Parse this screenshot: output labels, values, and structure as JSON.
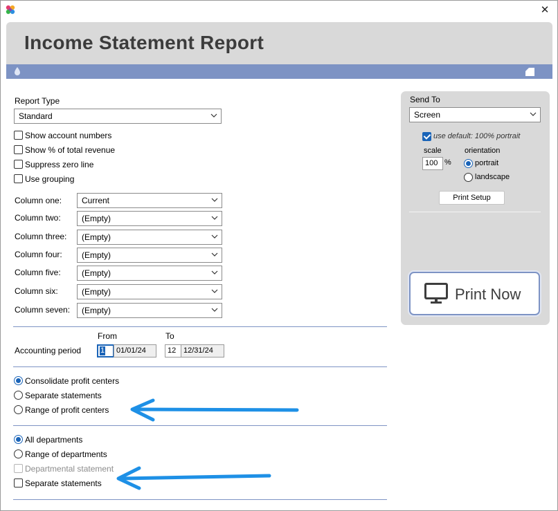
{
  "window": {
    "title": "Income Statement Report",
    "close_label": "✕"
  },
  "report_type": {
    "label": "Report Type",
    "value": "Standard",
    "options_checks": [
      {
        "label": "Show account numbers",
        "checked": false
      },
      {
        "label": "Show % of total revenue",
        "checked": false
      },
      {
        "label": "Suppress zero line",
        "checked": false
      },
      {
        "label": "Use grouping",
        "checked": false
      }
    ]
  },
  "columns": [
    {
      "label": "Column one:",
      "value": "Current"
    },
    {
      "label": "Column two:",
      "value": "(Empty)"
    },
    {
      "label": "Column three:",
      "value": "(Empty)"
    },
    {
      "label": "Column four:",
      "value": "(Empty)"
    },
    {
      "label": "Column five:",
      "value": "(Empty)"
    },
    {
      "label": "Column six:",
      "value": "(Empty)"
    },
    {
      "label": "Column seven:",
      "value": "(Empty)"
    }
  ],
  "period": {
    "label": "Accounting period",
    "from_label": "From",
    "to_label": "To",
    "from_num": "1",
    "from_date": "01/01/24",
    "to_num": "12",
    "to_date": "12/31/24"
  },
  "profit_centers": [
    {
      "label": "Consolidate profit centers",
      "selected": true
    },
    {
      "label": "Separate statements",
      "selected": false
    },
    {
      "label": "Range of profit centers",
      "selected": false
    }
  ],
  "departments": {
    "radios": [
      {
        "label": "All departments",
        "selected": true
      },
      {
        "label": "Range of departments",
        "selected": false
      }
    ],
    "checks": [
      {
        "label": "Departmental statement",
        "checked": false,
        "disabled": true
      },
      {
        "label": "Separate statements",
        "checked": false,
        "disabled": false
      }
    ]
  },
  "send_to": {
    "label": "Send To",
    "value": "Screen",
    "use_default_label": "use default: 100% portrait",
    "use_default_checked": true,
    "scale_label": "scale",
    "scale_value": "100",
    "percent": "%",
    "orientation_label": "orientation",
    "orientations": [
      {
        "label": "portrait",
        "selected": true
      },
      {
        "label": "landscape",
        "selected": false
      }
    ],
    "print_setup_label": "Print Setup",
    "print_now_label": "Print Now"
  },
  "colors": {
    "accent": "#7d93c4",
    "header_bg": "#d9d9d9",
    "radio_blue": "#1a64b8",
    "arrow_blue": "#1e90e6"
  },
  "icons": [
    "app-logo-icon",
    "close-icon",
    "droplet-icon",
    "page-icon",
    "chevron-down-icon",
    "monitor-icon",
    "arrow-left-icon"
  ]
}
